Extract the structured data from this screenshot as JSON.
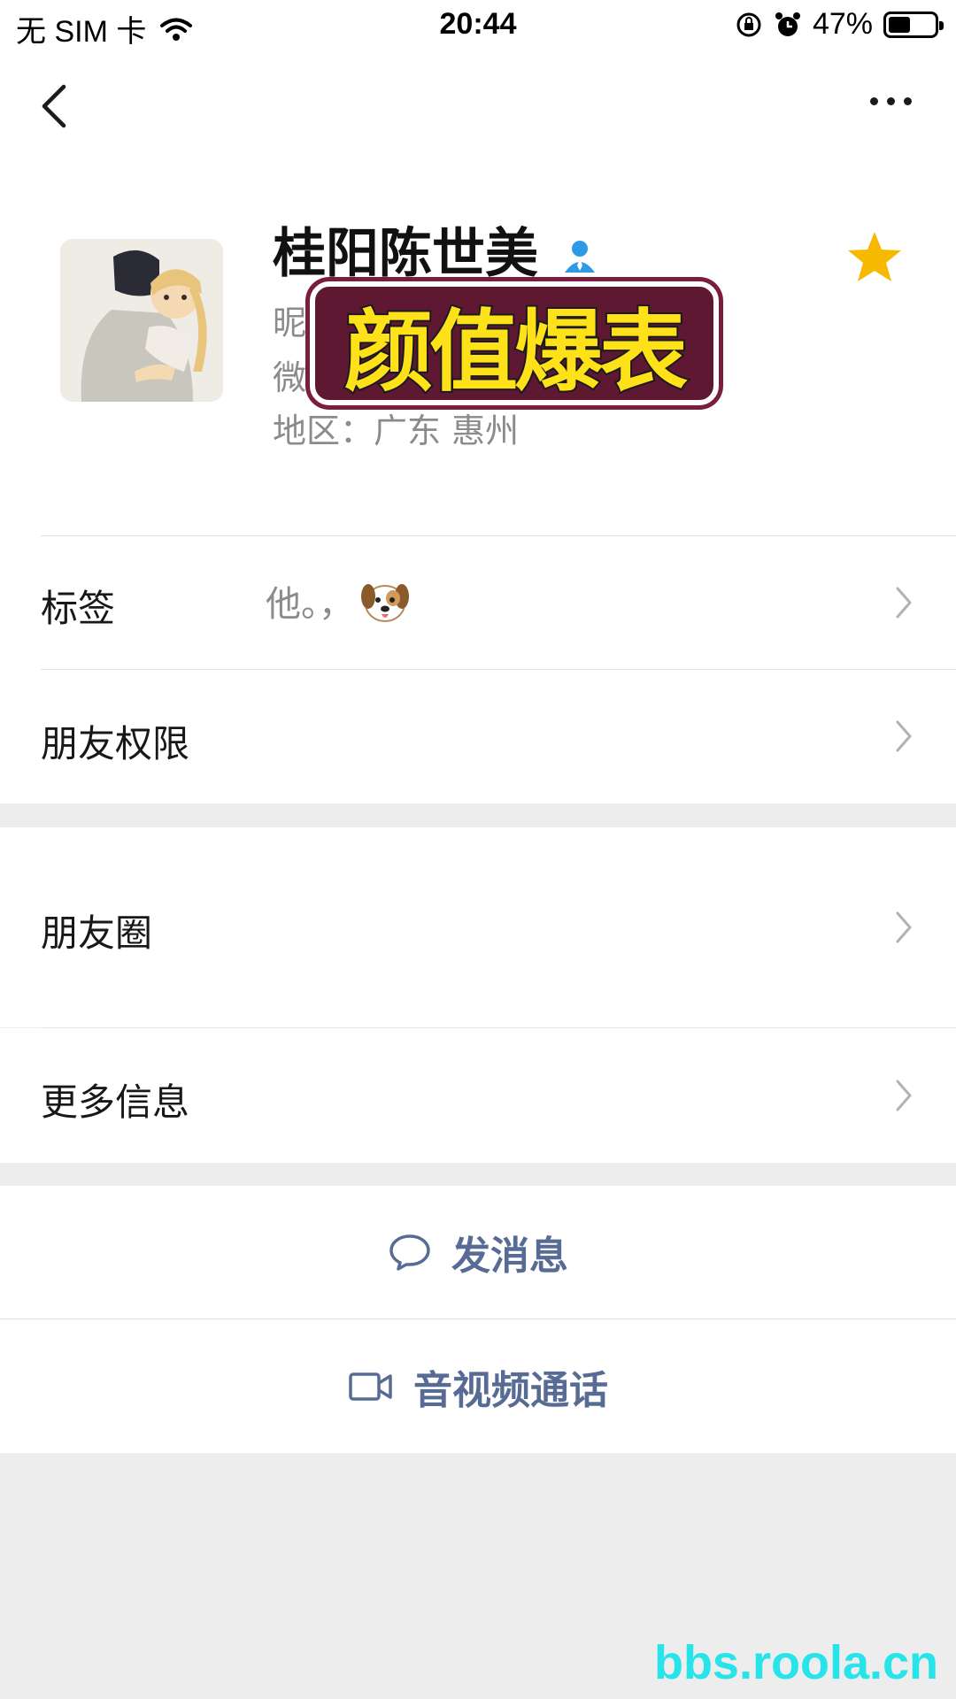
{
  "status_bar": {
    "carrier": "无 SIM 卡",
    "time": "20:44",
    "battery_percent": "47%",
    "battery_level": 0.47
  },
  "profile": {
    "name": "桂阳陈世美",
    "nickname_prefix": "昵",
    "wechat_prefix": "微",
    "region": "地区：广东 惠州",
    "starred": true,
    "star_color": "#f7b900"
  },
  "overlay_sticker": {
    "text": "颜值爆表",
    "text_color": "#ffe11a",
    "bg_color": "#5f1831"
  },
  "rows": {
    "tags_label": "标签",
    "tags_value": "他。，",
    "tags_emoji": "dog-face-icon",
    "friend_permissions": "朋友权限",
    "moments": "朋友圈",
    "more_info": "更多信息"
  },
  "actions": {
    "message": "发消息",
    "call": "音视频通话",
    "accent_color": "#576b95"
  },
  "watermark": "bbs.roola.cn"
}
